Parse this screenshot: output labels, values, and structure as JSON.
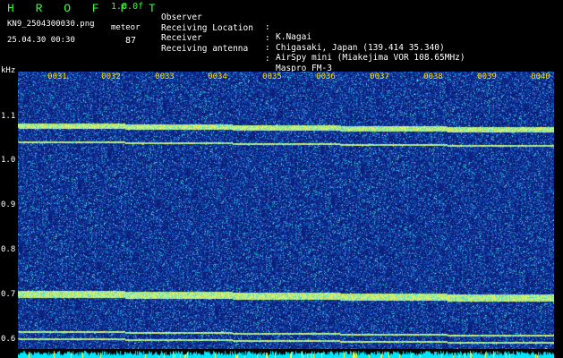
{
  "header": {
    "app_title": "H R O F F T",
    "version": "1.0.0f",
    "filename": "KN9_2504300030.png",
    "meteor_label": "meteor",
    "datetime": "25.04.30 00:30",
    "meteor_count": "87"
  },
  "info": [
    {
      "label": "Observer",
      "value": "K.Nagai"
    },
    {
      "label": "Receiving Location",
      "value": "Chigasaki, Japan (139.414 35.340)"
    },
    {
      "label": "Receiver",
      "value": "AirSpy mini (Miakejima VOR 108.65MHz)"
    },
    {
      "label": "Receiving antenna",
      "value": "Maspro FM-3"
    }
  ],
  "separator": ":",
  "axis": {
    "y_unit": "kHz",
    "y_ticks": [
      "1.1",
      "1.0",
      "0.9",
      "0.8",
      "0.7",
      "0.6"
    ],
    "x_ticks": [
      "0031",
      "0032",
      "0033",
      "0034",
      "0035",
      "0036",
      "0037",
      "0038",
      "0039",
      "0040"
    ]
  },
  "colors": {
    "background": "#0a2a8a",
    "title": "#3cff3c",
    "tick_labels": "#ffe000",
    "baseline": "#00e8ff"
  }
}
